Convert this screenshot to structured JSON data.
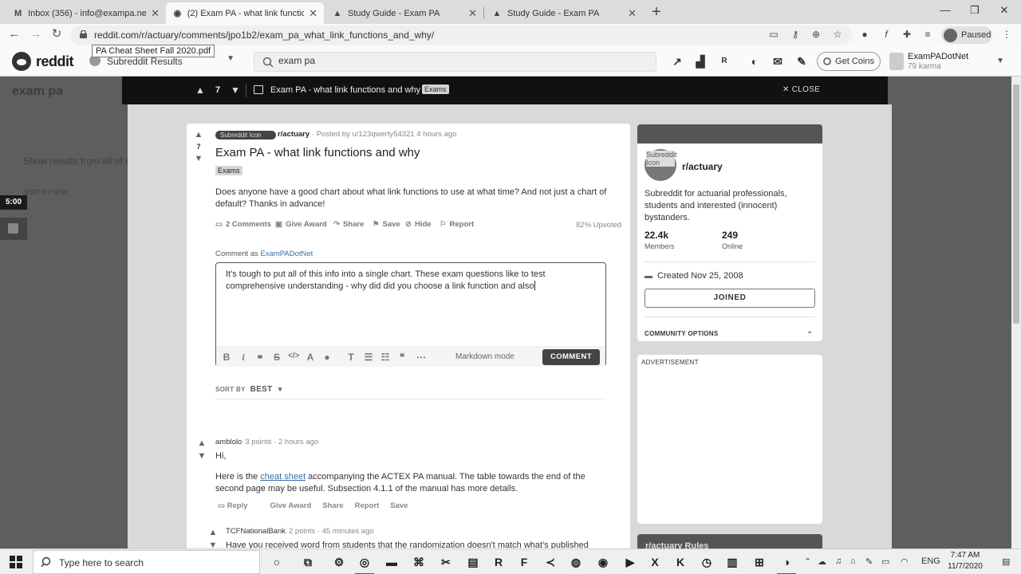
{
  "browser": {
    "tabs": [
      {
        "label": "Inbox (356) - info@exampa.net -",
        "icon": "gmail-icon"
      },
      {
        "label": "(2) Exam PA - what link functions",
        "icon": "reddit-icon"
      },
      {
        "label": "Study Guide - Exam PA",
        "icon": "drive-icon"
      },
      {
        "label": "Study Guide - Exam PA",
        "icon": "drive-icon"
      }
    ],
    "url": "reddit.com/r/actuary/comments/jpo1b2/exam_pa_what_link_functions_and_why/",
    "tooltip": "PA Cheat Sheet Fall 2020.pdf",
    "profile_status": "Paused"
  },
  "reddit_header": {
    "wordmark": "reddit",
    "dropdown_label": "Subreddit Results",
    "search_value": "exam pa",
    "get_coins_label": "Get Coins",
    "username": "ExamPADotNet",
    "karma": "79 karma"
  },
  "background": {
    "search_title": "exam pa",
    "sort_label": "SORT BY NEW",
    "show_results": "Show results from all of r/",
    "timer": "5:00"
  },
  "modal": {
    "vote_count": "7",
    "title": "Exam PA - what link functions and why",
    "flair": "Exams",
    "close_label": "CLOSE"
  },
  "post": {
    "subreddit_icon_alt": "Subreddit Icon",
    "subreddit": "r/actuary",
    "posted_by": "· Posted by u/123qwerty54321 4 hours ago",
    "votes": "7",
    "title": "Exam PA - what link functions and why",
    "flair": "Exams",
    "body": "Does anyone have a good chart about what link functions to use at what time? And not just a chart of default? Thanks in advance!",
    "actions": {
      "comments": "2 Comments",
      "award": "Give Award",
      "share": "Share",
      "save": "Save",
      "hide": "Hide",
      "report": "Report"
    },
    "upvoted": "82% Upvoted"
  },
  "comment_box": {
    "comment_as_prefix": "Comment as",
    "username": "ExamPADotNet",
    "text": "It's tough to put all of this info into a single chart.  These exam questions like to test comprehensive understanding - why did did you choose a link function and also",
    "markdown_label": "Markdown mode",
    "submit_label": "COMMENT"
  },
  "sort": {
    "label": "SORT BY",
    "value": "BEST"
  },
  "comments": [
    {
      "author": "amblolo",
      "meta": "3 points · 2 hours ago",
      "greeting": "Hi,",
      "pre_link": "Here is the ",
      "link": "cheat sheet",
      "post_link": " accompanying the ACTEX PA manual. The table towards the end of the second page may be useful. Subsection 4.1.1 of the manual has more details.",
      "actions": {
        "reply": "Reply",
        "award": "Give Award",
        "share": "Share",
        "report": "Report",
        "save": "Save"
      }
    },
    {
      "author": "TCFNationalBank",
      "meta": "2 points · 45 minutes ago",
      "text": "Have you received word from students that the randomization doesn't match what's published even with the same seed setting? It could be because I'm running a different version of R than"
    }
  ],
  "sidebar": {
    "icon_alt": "Subreddit Icon",
    "name": "r/actuary",
    "description": "Subreddit for actuarial professionals, students and interested (innocent) bystanders.",
    "members_value": "22.4k",
    "members_label": "Members",
    "online_value": "249",
    "online_label": "Online",
    "created": "Created Nov 25, 2008",
    "joined_label": "JOINED",
    "community_options": "COMMUNITY OPTIONS",
    "advertisement": "ADVERTISEMENT",
    "rules_title": "r/actuary Rules"
  },
  "taskbar": {
    "search_placeholder": "Type here to search",
    "language": "ENG",
    "time": "7:47 AM",
    "date": "11/7/2020"
  }
}
